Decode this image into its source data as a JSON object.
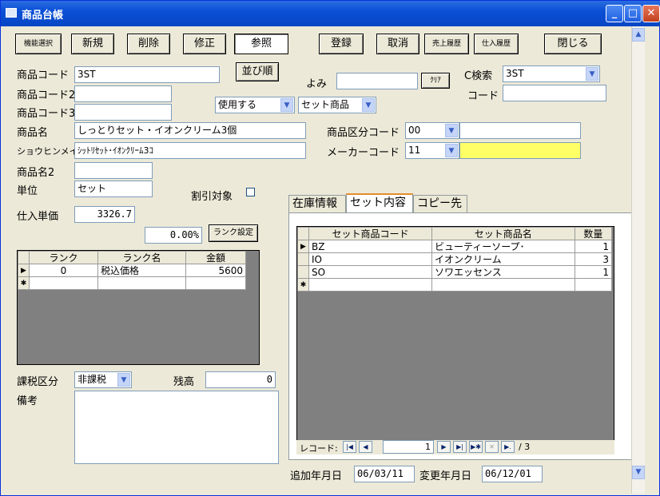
{
  "window": {
    "title": "商品台帳"
  },
  "toolbar": {
    "kino": "機能選択",
    "shinki": "新規",
    "sakujo": "削除",
    "shusei": "修正",
    "shosho": "参照",
    "toroku": "登録",
    "torikeshi": "取消",
    "uriage": "売上履歴",
    "shiire": "仕入履歴",
    "tojiru": "閉じる"
  },
  "labels": {
    "code1": "商品コード",
    "code2": "商品コード2",
    "code3": "商品コード3",
    "name": "商品名",
    "kana": "ショウヒンメイ",
    "name2": "商品名2",
    "unit": "単位",
    "cost": "仕入単価",
    "yomi": "よみ",
    "csearch": "C検索",
    "code": "コード",
    "kubun": "商品区分コード",
    "maker": "メーカーコード",
    "discount": "割引対象",
    "tax": "課税区分",
    "stock": "残高",
    "memo": "備考",
    "added": "追加年月日",
    "changed": "変更年月日"
  },
  "buttons": {
    "sort": "並び順",
    "clear": "ｸﾘｱ",
    "rank_set": "ランク設定"
  },
  "fields": {
    "code1": "3ST",
    "code2": "",
    "code3": "",
    "use": "使用する",
    "set_type": "セット商品",
    "name": "しっとりセット・イオンクリーム3個",
    "kana": "ｼｯﾄﾘｾｯﾄ･ｲｵﾝｸﾘｰﾑ3ｺ",
    "name2": "",
    "unit": "セット",
    "cost": "3326.7",
    "rate": "0.00%",
    "yomi": "",
    "csearch": "3ST",
    "code": "",
    "kubun": "00",
    "kubun_name": "",
    "maker": "11",
    "maker_name": "",
    "tax": "非課税",
    "stock": "0",
    "memo": "",
    "added": "06/03/11",
    "changed": "06/12/01"
  },
  "rank_table": {
    "headers": [
      "ランク",
      "ランク名",
      "金額"
    ],
    "rows": [
      [
        "0",
        "税込価格",
        "5600"
      ]
    ]
  },
  "tabs": [
    "在庫情報",
    "セット内容",
    "コピー先"
  ],
  "set_table": {
    "headers": [
      "セット商品コード",
      "セット商品名",
      "数量"
    ],
    "rows": [
      [
        "BZ",
        "ビューティーソープ･",
        "1"
      ],
      [
        "IO",
        "イオンクリーム",
        "3"
      ],
      [
        "SO",
        "ソワエッセンス",
        "1"
      ]
    ]
  },
  "record_nav": {
    "label": "レコード:",
    "current": "1",
    "total": "/ 3"
  },
  "colors": {
    "title_bar": "#0A4FD6",
    "highlight": "#FFFF66",
    "window_bg": "#ECE9D8",
    "grid_bg": "#808080"
  }
}
